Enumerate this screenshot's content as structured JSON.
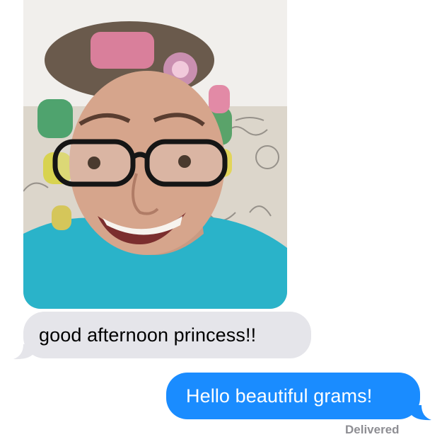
{
  "conversation": {
    "messages": [
      {
        "direction": "incoming",
        "type": "photo",
        "image_description": "selfie of smiling older woman in hair rollers, glasses and teal shirt"
      },
      {
        "direction": "incoming",
        "type": "text",
        "text": "good afternoon princess!!"
      },
      {
        "direction": "outgoing",
        "type": "text",
        "text": "Hello beautiful grams!"
      }
    ],
    "status": "Delivered"
  },
  "colors": {
    "incoming_bubble": "#e5e5ea",
    "outgoing_bubble": "#1a8cff",
    "status_text": "#8e8e93"
  }
}
